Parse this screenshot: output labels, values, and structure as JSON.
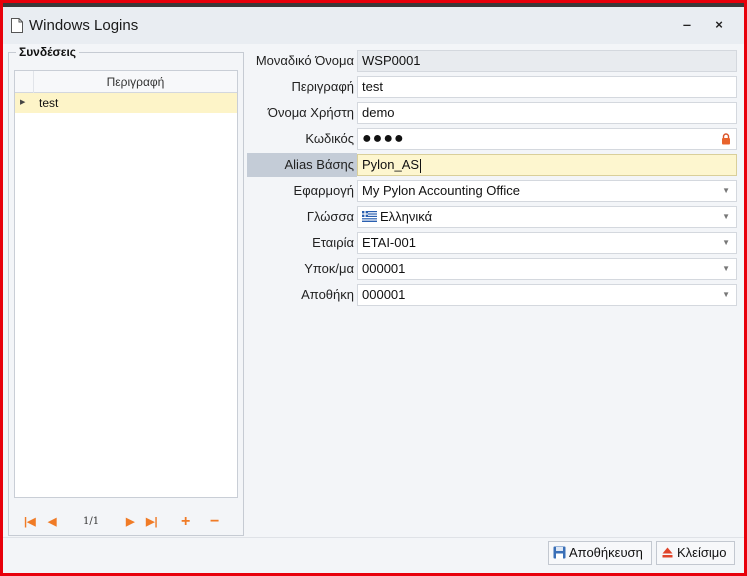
{
  "window": {
    "title": "Windows Logins",
    "minimize_glyph": "‒",
    "close_glyph": "×"
  },
  "connections": {
    "group_title": "Συνδέσεις",
    "column_header": "Περιγραφή",
    "rows": [
      {
        "description": "test",
        "selected": true
      }
    ],
    "pager": {
      "count": "1/1"
    }
  },
  "form": {
    "unique_name": {
      "label": "Μοναδικό Όνομα",
      "value": "WSP0001"
    },
    "description": {
      "label": "Περιγραφή",
      "value": "test"
    },
    "username": {
      "label": "Όνομα Χρήστη",
      "value": "demo"
    },
    "password": {
      "label": "Κωδικός",
      "value": "●●●●"
    },
    "db_alias": {
      "label": "Alias Βάσης",
      "value": "Pylon_AS"
    },
    "application": {
      "label": "Εφαρμογή",
      "value": "My Pylon Accounting Office"
    },
    "language": {
      "label": "Γλώσσα",
      "value": "Ελληνικά"
    },
    "company": {
      "label": "Εταιρία",
      "value": "ΕΤΑΙ-001"
    },
    "branch": {
      "label": "Υποκ/μα",
      "value": "000001"
    },
    "warehouse": {
      "label": "Αποθήκη",
      "value": "000001"
    }
  },
  "actions": {
    "save_label": "Αποθήκευση",
    "close_label": "Κλείσιμο"
  },
  "colors": {
    "accent_orange": "#f07b26",
    "focus_yellow": "#fdf6cf",
    "selected_row": "#fdf4c8",
    "frame_red": "#e8000b"
  }
}
